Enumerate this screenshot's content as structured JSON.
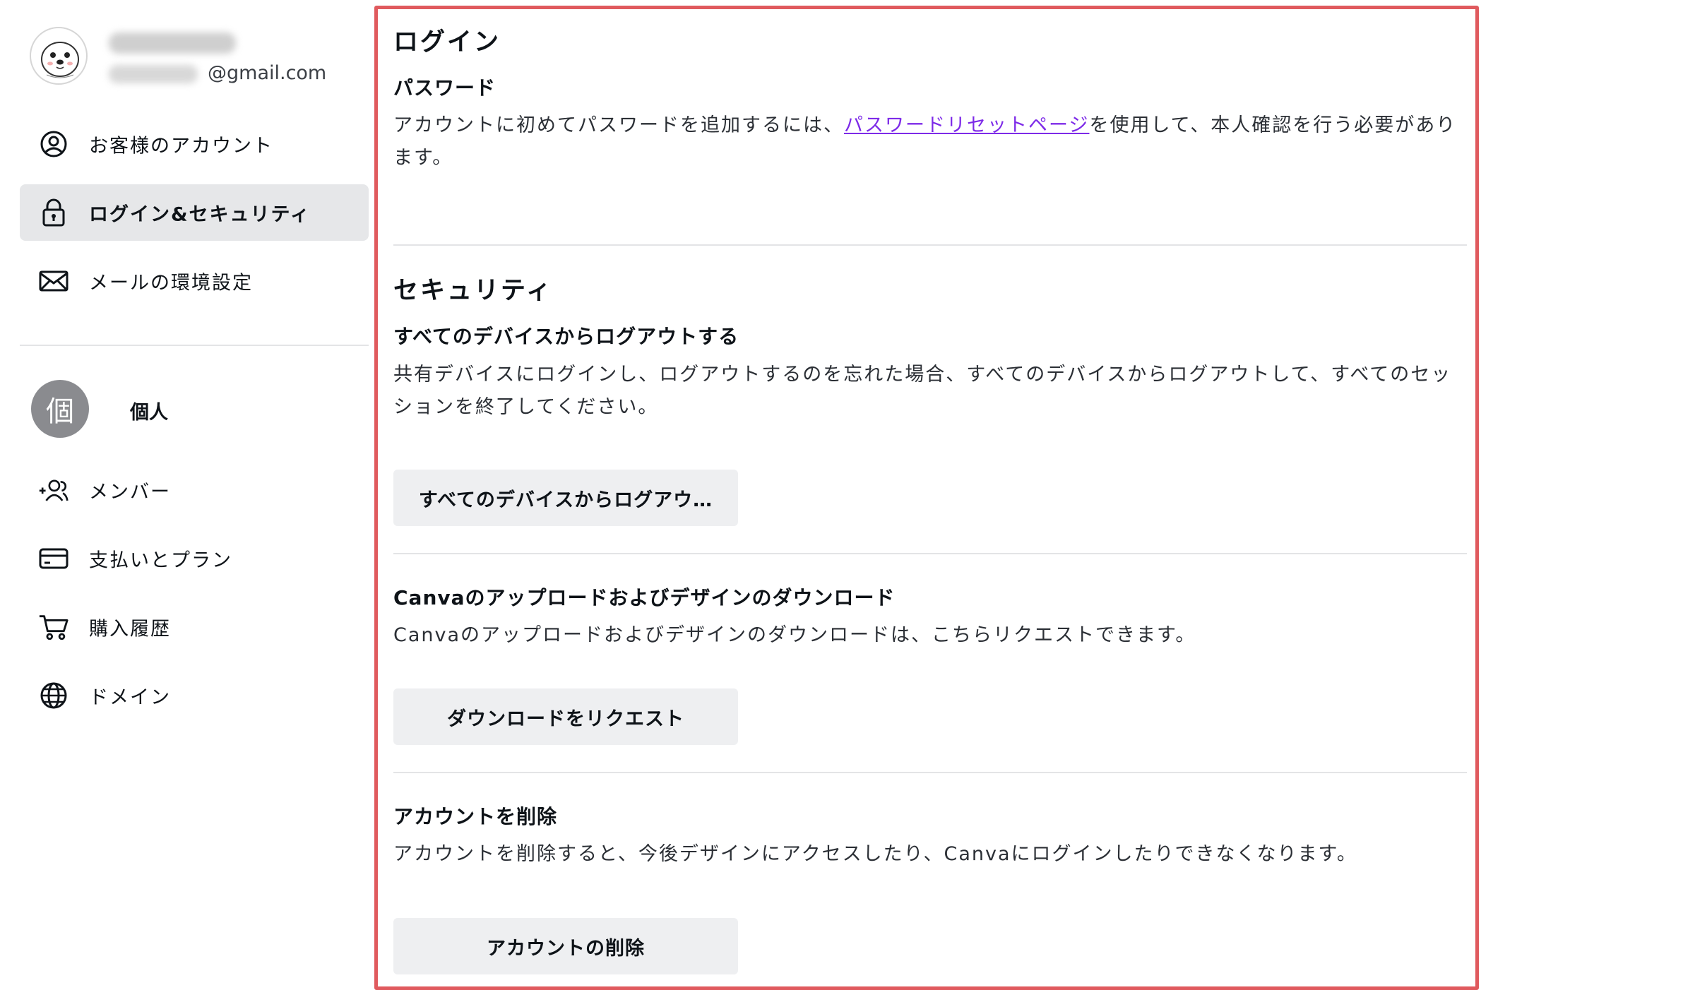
{
  "user": {
    "email_domain": "@gmail.com"
  },
  "nav": {
    "items": [
      {
        "label": "お客様のアカウント",
        "icon": "user-circle-icon"
      },
      {
        "label": "ログイン&セキュリティ",
        "icon": "lock-icon",
        "active": true
      },
      {
        "label": "メールの環境設定",
        "icon": "mail-icon"
      }
    ],
    "team": {
      "avatar_char": "個",
      "label": "個人"
    },
    "team_items": [
      {
        "label": "メンバー",
        "icon": "add-people-icon"
      },
      {
        "label": "支払いとプラン",
        "icon": "credit-card-icon"
      },
      {
        "label": "購入履歴",
        "icon": "cart-icon"
      },
      {
        "label": "ドメイン",
        "icon": "globe-icon"
      }
    ]
  },
  "login": {
    "title": "ログイン",
    "password_title": "パスワード",
    "password_text_before": "アカウントに初めてパスワードを追加するには、",
    "password_link": "パスワードリセットページ",
    "password_text_after": "を使用して、本人確認を行う必要があります。"
  },
  "security": {
    "title": "セキュリティ",
    "logout_title": "すべてのデバイスからログアウトする",
    "logout_text": "共有デバイスにログインし、ログアウトするのを忘れた場合、すべてのデバイスからログアウトして、すべてのセッションを終了してください。",
    "logout_button": "すべてのデバイスからログアウ…",
    "download_title": "Canvaのアップロードおよびデザインのダウンロード",
    "download_text": "Canvaのアップロードおよびデザインのダウンロードは、こちらリクエストできます。",
    "download_button": "ダウンロードをリクエスト",
    "delete_title": "アカウントを削除",
    "delete_text": "アカウントを削除すると、今後デザインにアクセスしたり、Canvaにログインしたりできなくなります。",
    "delete_button": "アカウントの削除"
  },
  "colors": {
    "highlight_border": "#e05a5e",
    "link": "#7d2ae8",
    "active_nav_bg": "#e6e7e9",
    "button_bg": "#eeeff1"
  }
}
